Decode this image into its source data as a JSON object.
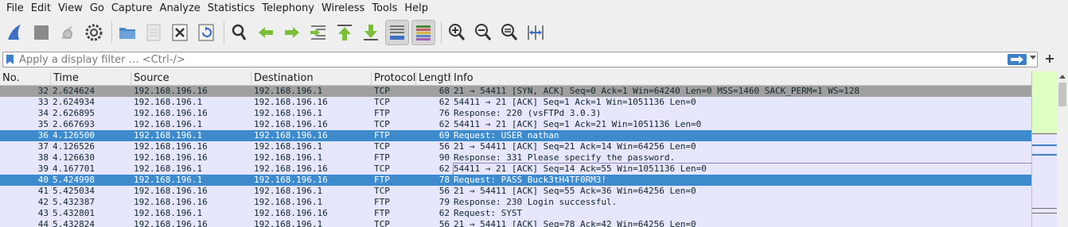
{
  "menu": [
    "File",
    "Edit",
    "View",
    "Go",
    "Capture",
    "Analyze",
    "Statistics",
    "Telephony",
    "Wireless",
    "Tools",
    "Help"
  ],
  "toolbar": {
    "buttons": [
      "start-capture",
      "stop-capture",
      "restart-capture",
      "capture-options",
      "open-file",
      "save-file",
      "close-file",
      "reload-file",
      "find-packet",
      "go-back",
      "go-forward",
      "go-to-packet",
      "go-first",
      "go-last",
      "auto-scroll",
      "colorize",
      "zoom-in",
      "zoom-out",
      "zoom-normal",
      "resize-columns"
    ],
    "pressed": [
      "auto-scroll",
      "colorize"
    ]
  },
  "filter": {
    "placeholder": "Apply a display filter … <Ctrl-/>",
    "value": "",
    "add_label": "+"
  },
  "columns": [
    "No.",
    "Time",
    "Source",
    "Destination",
    "Protocol",
    "Length",
    "Info"
  ],
  "packets": [
    {
      "no": "32",
      "time": "2.624624",
      "src": "192.168.196.16",
      "dst": "192.168.196.1",
      "proto": "TCP",
      "len": "68",
      "info": "21 → 54411 [SYN, ACK] Seq=0 Ack=1 Win=64240 Len=0 MSS=1460 SACK_PERM=1 WS=128",
      "style": "dark"
    },
    {
      "no": "33",
      "time": "2.624934",
      "src": "192.168.196.1",
      "dst": "192.168.196.16",
      "proto": "TCP",
      "len": "62",
      "info": "54411 → 21 [ACK] Seq=1 Ack=1 Win=1051136 Len=0",
      "style": "tcp"
    },
    {
      "no": "34",
      "time": "2.626895",
      "src": "192.168.196.16",
      "dst": "192.168.196.1",
      "proto": "FTP",
      "len": "76",
      "info": "Response: 220 (vsFTPd 3.0.3)",
      "style": "ftp"
    },
    {
      "no": "35",
      "time": "2.667693",
      "src": "192.168.196.1",
      "dst": "192.168.196.16",
      "proto": "TCP",
      "len": "62",
      "info": "54411 → 21 [ACK] Seq=1 Ack=21 Win=1051136 Len=0",
      "style": "tcp"
    },
    {
      "no": "36",
      "time": "4.126500",
      "src": "192.168.196.1",
      "dst": "192.168.196.16",
      "proto": "FTP",
      "len": "69",
      "info": "Request: USER nathan",
      "style": "selected"
    },
    {
      "no": "37",
      "time": "4.126526",
      "src": "192.168.196.16",
      "dst": "192.168.196.1",
      "proto": "TCP",
      "len": "56",
      "info": "21 → 54411 [ACK] Seq=21 Ack=14 Win=64256 Len=0",
      "style": "tcp"
    },
    {
      "no": "38",
      "time": "4.126630",
      "src": "192.168.196.16",
      "dst": "192.168.196.1",
      "proto": "FTP",
      "len": "90",
      "info": "Response: 331 Please specify the password.",
      "style": "ftp"
    },
    {
      "no": "39",
      "time": "4.167701",
      "src": "192.168.196.1",
      "dst": "192.168.196.16",
      "proto": "TCP",
      "len": "62",
      "info": "54411 → 21 [ACK] Seq=14 Ack=55 Win=1051136 Len=0",
      "style": "tcp-focus"
    },
    {
      "no": "40",
      "time": "5.424998",
      "src": "192.168.196.1",
      "dst": "192.168.196.16",
      "proto": "FTP",
      "len": "78",
      "info": "Request: PASS Buck3tH4TF0RM3!",
      "style": "selected"
    },
    {
      "no": "41",
      "time": "5.425034",
      "src": "192.168.196.16",
      "dst": "192.168.196.1",
      "proto": "TCP",
      "len": "56",
      "info": "21 → 54411 [ACK] Seq=55 Ack=36 Win=64256 Len=0",
      "style": "tcp"
    },
    {
      "no": "42",
      "time": "5.432387",
      "src": "192.168.196.16",
      "dst": "192.168.196.1",
      "proto": "FTP",
      "len": "79",
      "info": "Response: 230 Login successful.",
      "style": "ftp"
    },
    {
      "no": "43",
      "time": "5.432801",
      "src": "192.168.196.1",
      "dst": "192.168.196.16",
      "proto": "FTP",
      "len": "62",
      "info": "Request: SYST",
      "style": "ftp"
    },
    {
      "no": "44",
      "time": "5.432824",
      "src": "192.168.196.16",
      "dst": "192.168.196.1",
      "proto": "TCP",
      "len": "56",
      "info": "21 → 54411 [ACK] Seq=78 Ack=42 Win=64256 Len=0",
      "style": "tcp"
    }
  ],
  "colors": {
    "row_bg": "#e7e6ff",
    "row_dark": "#a0a0a0",
    "selected": "#3d8bcd",
    "minimap_green": "#dfffc2"
  }
}
